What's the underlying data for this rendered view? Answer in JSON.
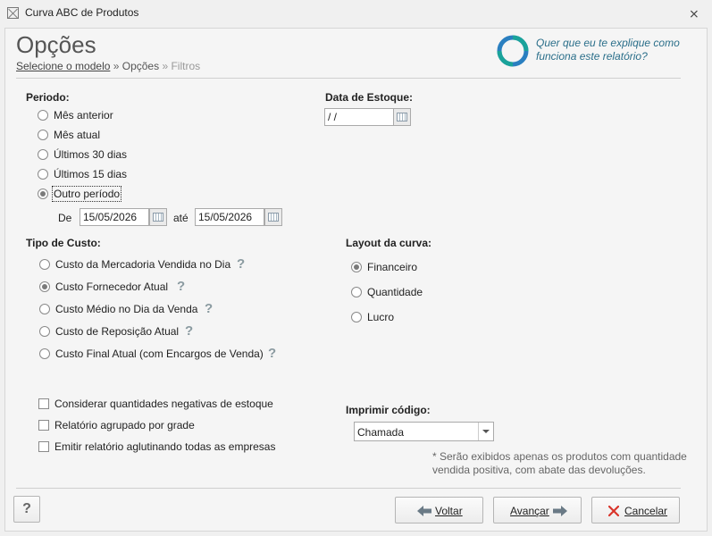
{
  "window": {
    "title": "Curva ABC de Produtos"
  },
  "header": {
    "title": "Opções",
    "breadcrumb": {
      "link": "Selecione o modelo",
      "sep1": " » ",
      "current": "Opções",
      "sep2": " » ",
      "next": "Filtros"
    },
    "help_text": "Quer que eu te explique como funciona este relatório?"
  },
  "periodo": {
    "label": "Periodo:",
    "options": [
      "Mês anterior",
      "Mês atual",
      "Últimos 30 dias",
      "Últimos 15 dias",
      "Outro período"
    ],
    "selected": "Outro período",
    "from_label": "De",
    "from_value": "15/05/2026",
    "to_label": "até",
    "to_value": "15/05/2026"
  },
  "estoque": {
    "label": "Data de Estoque:",
    "value": " /  /"
  },
  "custo": {
    "label": "Tipo de Custo:",
    "options": [
      "Custo da Mercadoria Vendida no Dia",
      "Custo Fornecedor Atual",
      "Custo Médio no Dia da Venda",
      "Custo de Reposição Atual",
      "Custo Final Atual (com Encargos de Venda)"
    ],
    "selected": "Custo Fornecedor Atual",
    "help_glyph": "?"
  },
  "layout": {
    "label": "Layout da curva:",
    "options": [
      "Financeiro",
      "Quantidade",
      "Lucro"
    ],
    "selected": "Financeiro"
  },
  "checks": [
    {
      "label": "Considerar quantidades negativas de estoque",
      "checked": false
    },
    {
      "label": "Relatório agrupado por grade",
      "checked": false
    },
    {
      "label": "Emitir relatório aglutinando todas as empresas",
      "checked": false
    }
  ],
  "codigo": {
    "label": "Imprimir código:",
    "value": "Chamada"
  },
  "note": "* Serão exibidos apenas os produtos com quantidade vendida positiva, com abate das devoluções.",
  "buttons": {
    "help": "?",
    "back": "Voltar",
    "next": "Avançar",
    "cancel": "Cancelar"
  },
  "colors": {
    "accent": "#2b6f8a",
    "ring_teal": "#1aa39a",
    "ring_blue": "#2a7fc0",
    "cancel_x": "#d9352b",
    "arrow": "#6a7a86"
  }
}
